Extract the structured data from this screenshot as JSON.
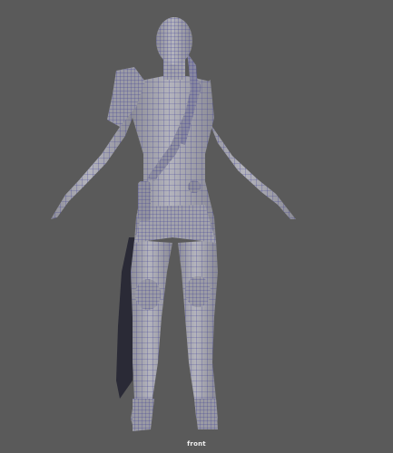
{
  "viewport": {
    "camera_label": "front",
    "background_color": "#5a5a5a",
    "mesh_fill_color": "#a7a7b0",
    "wireframe_color": "#2e2e8f",
    "cape_color": "#2a2a36"
  }
}
